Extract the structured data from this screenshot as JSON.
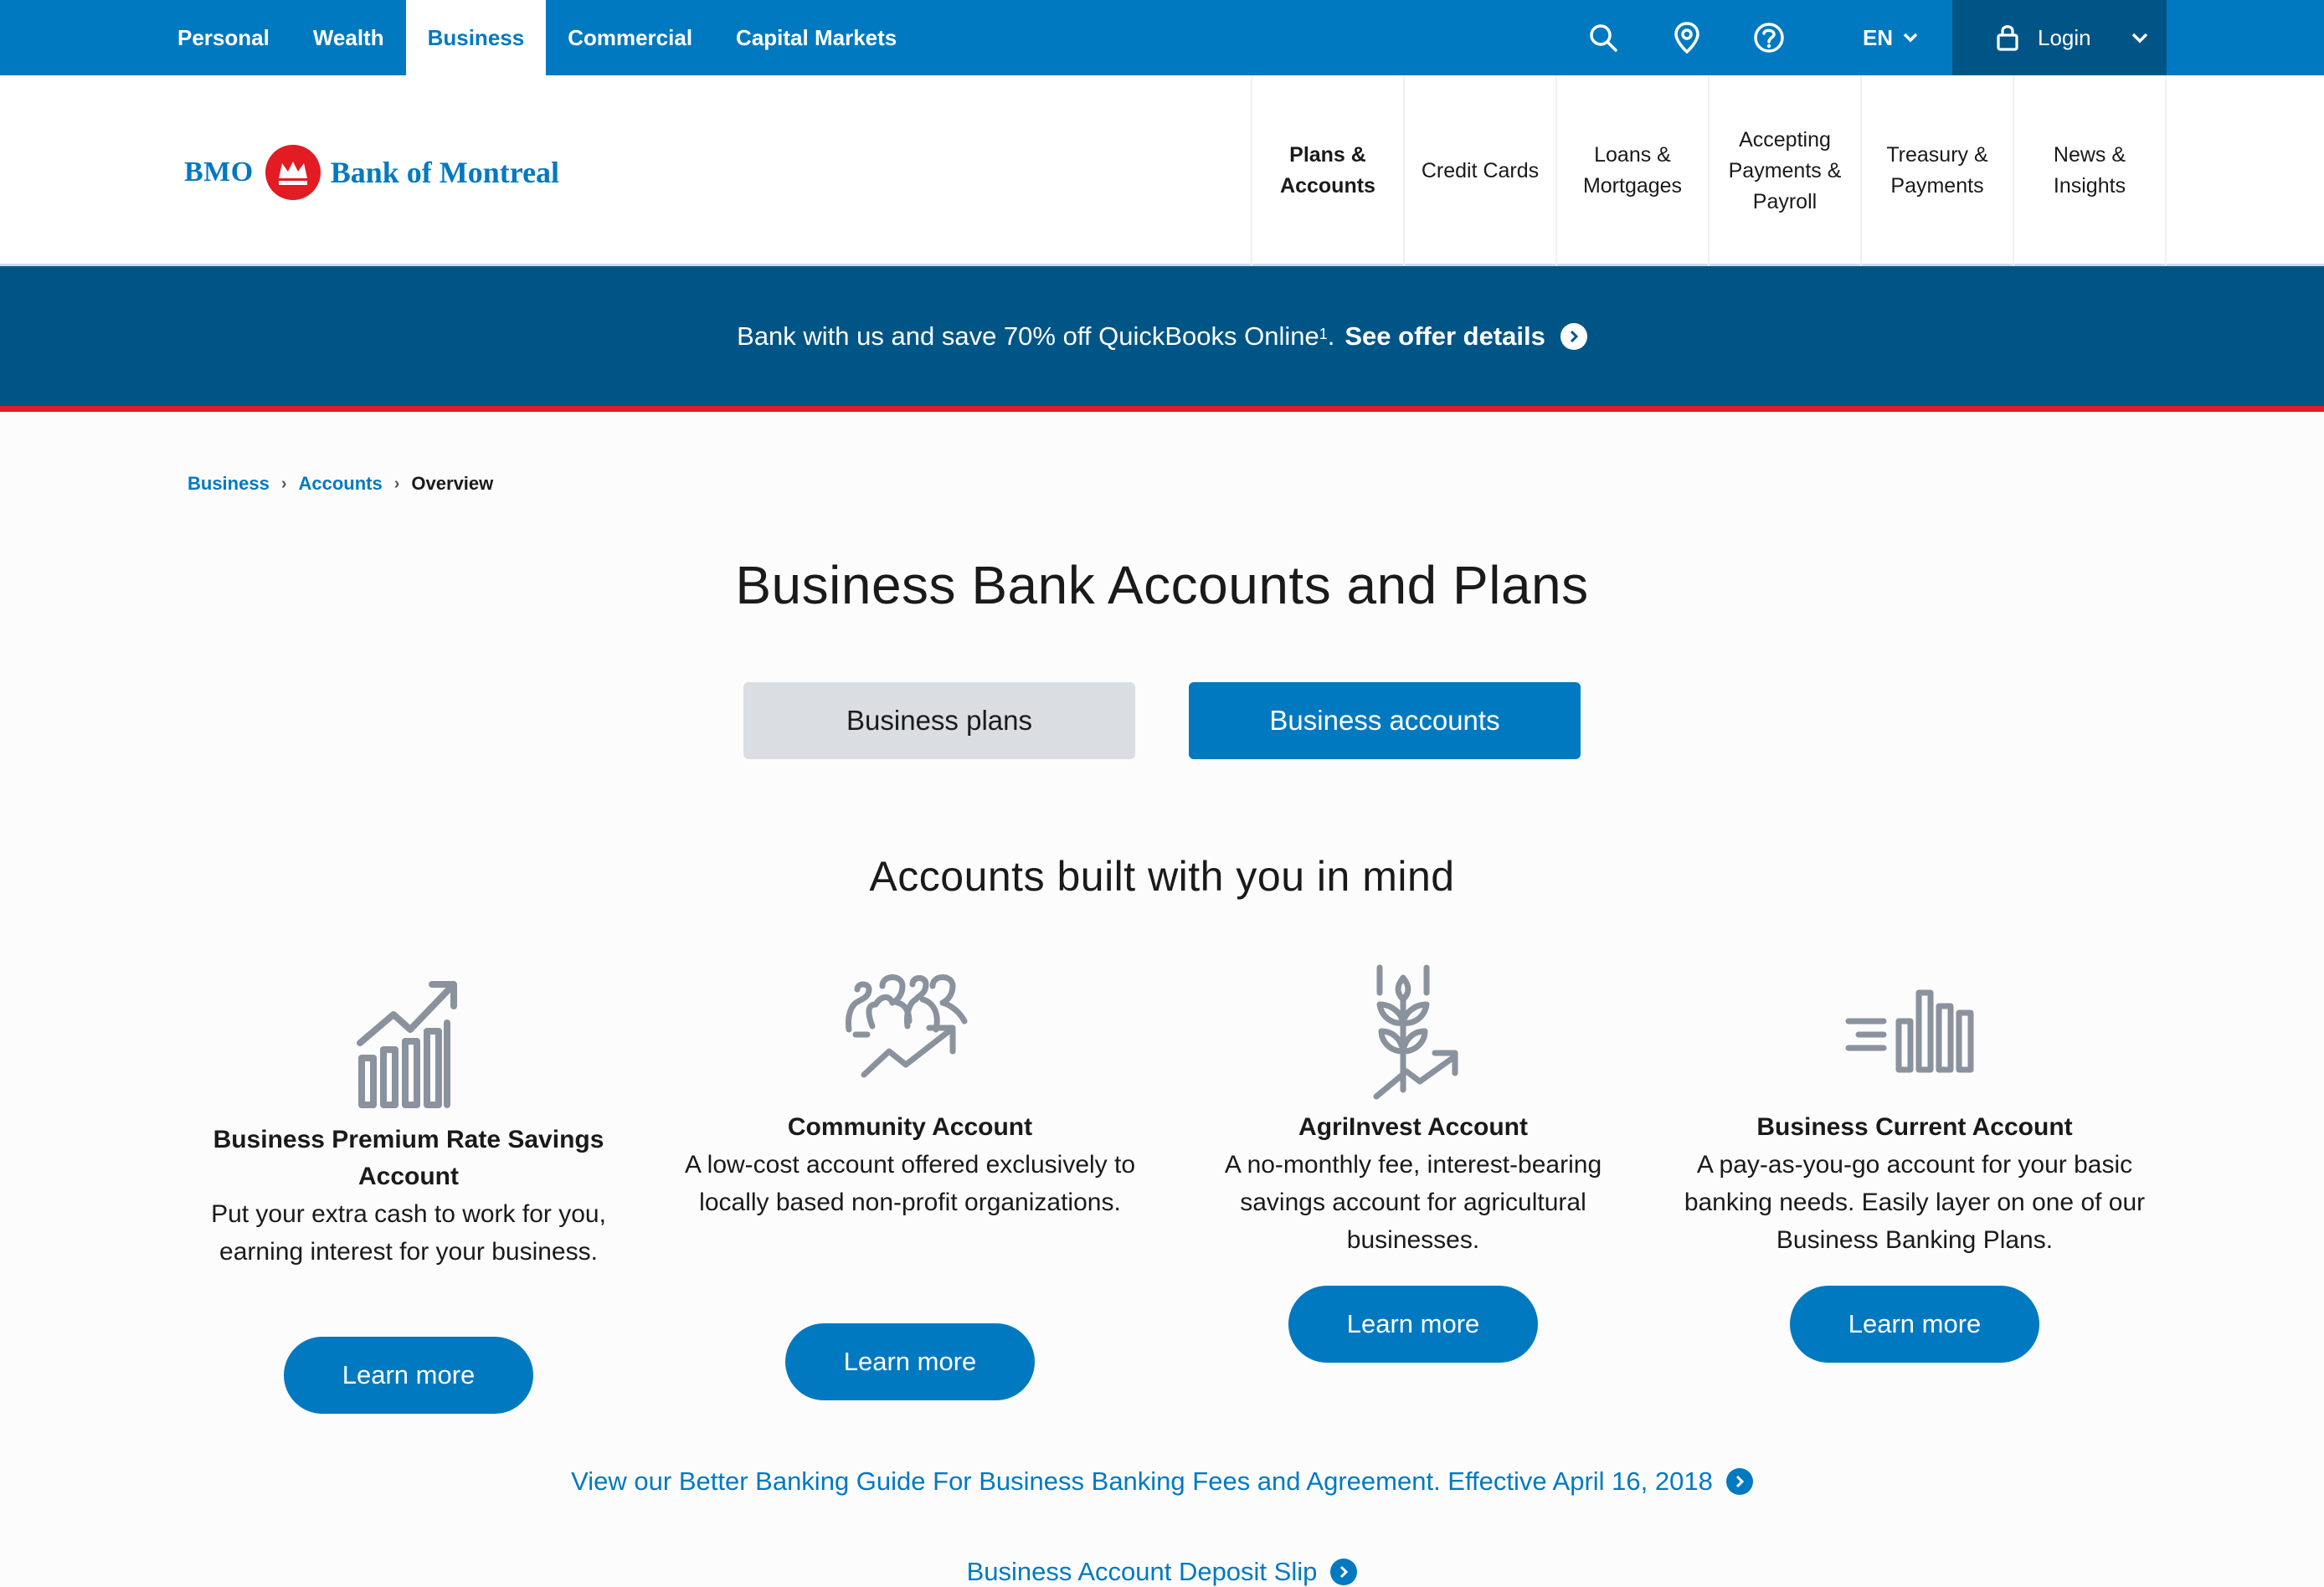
{
  "top_nav": {
    "items": [
      {
        "label": "Personal",
        "active": false
      },
      {
        "label": "Wealth",
        "active": false
      },
      {
        "label": "Business",
        "active": true
      },
      {
        "label": "Commercial",
        "active": false
      },
      {
        "label": "Capital Markets",
        "active": false
      }
    ],
    "search_icon": "search-icon",
    "location_icon": "location-pin-icon",
    "help_icon": "help-icon",
    "language": "EN",
    "login_label": "Login"
  },
  "header": {
    "logo_bmo": "BMO",
    "logo_name": "Bank of Montreal",
    "nav": [
      {
        "label": "Plans & Accounts",
        "current": true
      },
      {
        "label": "Credit Cards",
        "current": false
      },
      {
        "label": "Loans & Mortgages",
        "current": false
      },
      {
        "label": "Accepting Payments & Payroll",
        "current": false
      },
      {
        "label": "Treasury & Payments",
        "current": false
      },
      {
        "label": "News & Insights",
        "current": false
      }
    ]
  },
  "promo": {
    "text": "Bank with us and save 70% off QuickBooks Online",
    "superscript": "1",
    "separator": ".",
    "link_label": "See offer details"
  },
  "breadcrumb": {
    "items": [
      "Business",
      "Accounts"
    ],
    "current": "Overview"
  },
  "main": {
    "title": "Business Bank Accounts and Plans",
    "toggle_plans": "Business plans",
    "toggle_accounts": "Business accounts",
    "section_title": "Accounts built with you in mind",
    "cards": [
      {
        "icon": "growth-chart-icon",
        "title": "Business Premium Rate Savings Account",
        "description": "Put your extra cash to work for you, earning interest for your business.",
        "button": "Learn more"
      },
      {
        "icon": "community-group-icon",
        "title": "Community Account",
        "description": "A low-cost account offered exclusively to locally based non-profit organizations.",
        "button": "Learn more"
      },
      {
        "icon": "wheat-growth-icon",
        "title": "AgriInvest Account",
        "description": "A no-monthly fee, interest-bearing savings account for agricultural businesses.",
        "button": "Learn more"
      },
      {
        "icon": "fast-bars-icon",
        "title": "Business Current Account",
        "description": "A pay-as-you-go account for your basic banking needs. Easily layer on one of our Business Banking Plans.",
        "button": "Learn more"
      }
    ],
    "guide_link": "View our Better Banking Guide For Business Banking Fees and Agreement. Effective April 16, 2018",
    "deposit_link": "Business Account Deposit Slip"
  },
  "colors": {
    "brand_blue": "#0079c1",
    "dark_blue": "#005587",
    "red": "#e31b23",
    "icon_gray": "#8a929e"
  }
}
